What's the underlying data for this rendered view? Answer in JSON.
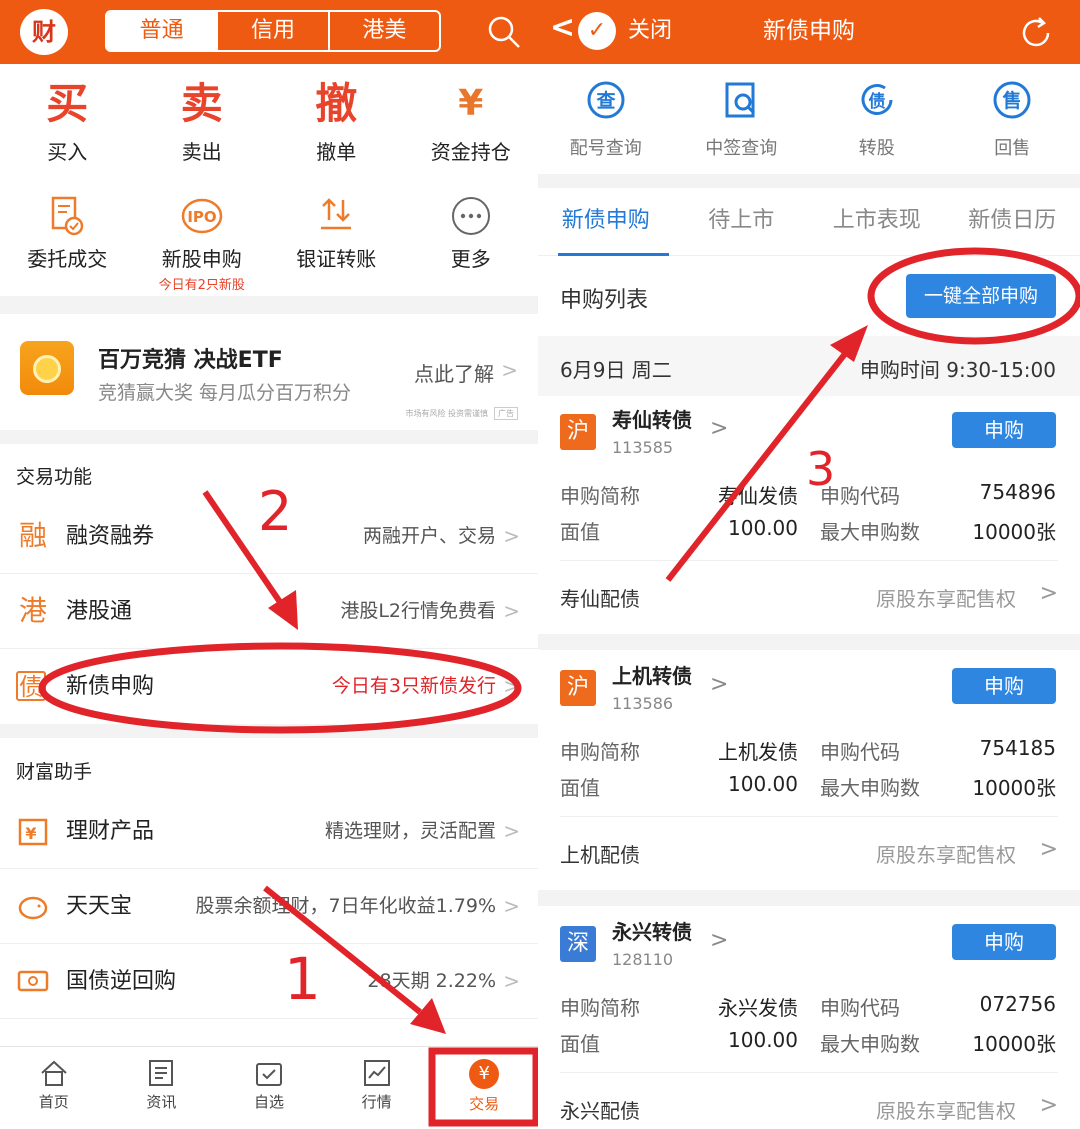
{
  "left": {
    "header": {
      "avatar_glyph": "财",
      "segments": [
        "普通",
        "信用",
        "港美"
      ]
    },
    "main_actions": [
      {
        "glyph": "买",
        "label": "买入"
      },
      {
        "glyph": "卖",
        "label": "卖出"
      },
      {
        "glyph": "撤",
        "label": "撤单"
      },
      {
        "glyph": "¥",
        "label": "资金持仓"
      }
    ],
    "sub_actions": [
      {
        "label": "委托成交",
        "sub": ""
      },
      {
        "label": "新股申购",
        "sub": "今日有2只新股"
      },
      {
        "label": "银证转账",
        "sub": ""
      },
      {
        "label": "更多",
        "sub": ""
      }
    ],
    "promo": {
      "title": "百万竞猜 决战ETF",
      "subtitle": "竞猜赢大奖 每月瓜分百万积分",
      "cta": "点此了解",
      "disclaimer": "市场有风险 投资需谨慎",
      "ad_tag": "广告"
    },
    "trade_section": {
      "title": "交易功能",
      "rows": [
        {
          "icon_glyph": "融",
          "label": "融资融券",
          "right": "两融开户、交易"
        },
        {
          "icon_glyph": "港",
          "label": "港股通",
          "right": "港股L2行情免费看"
        },
        {
          "icon_glyph": "债",
          "label": "新债申购",
          "right": "今日有3只新债发行"
        }
      ]
    },
    "wealth_section": {
      "title": "财富助手",
      "rows": [
        {
          "label": "理财产品",
          "right": "精选理财，灵活配置"
        },
        {
          "label": "天天宝",
          "right": "股票余额理财，7日年化收益1.79%"
        },
        {
          "label": "国债逆回购",
          "right": "28天期 2.22%"
        }
      ]
    },
    "bottom_nav": [
      {
        "label": "首页",
        "icon": "home-icon"
      },
      {
        "label": "资讯",
        "icon": "news-icon"
      },
      {
        "label": "自选",
        "icon": "watchlist-icon"
      },
      {
        "label": "行情",
        "icon": "market-icon"
      },
      {
        "label": "交易",
        "icon": "trade-icon"
      }
    ],
    "annotations": [
      "2",
      "1"
    ]
  },
  "right": {
    "header": {
      "back": "<",
      "close": "关闭",
      "title": "新债申购"
    },
    "quick_icons": [
      {
        "glyph": "查",
        "label": "配号查询"
      },
      {
        "glyph": "",
        "label": "中签查询"
      },
      {
        "glyph": "债",
        "label": "转股"
      },
      {
        "glyph": "售",
        "label": "回售"
      }
    ],
    "tabs": [
      "新债申购",
      "待上市",
      "上市表现",
      "新债日历"
    ],
    "list_title": "申购列表",
    "subscribe_all": "一键全部申购",
    "date": "6月9日 周二",
    "time": "申购时间 9:30-15:00",
    "annotation": "3",
    "field_labels": {
      "short_name": "申购简称",
      "code": "申购代码",
      "face": "面值",
      "max": "最大申购数"
    },
    "bonds": [
      {
        "market": "沪",
        "market_color": "#ee6a1c",
        "name": "寿仙转债",
        "code": "113585",
        "btn": "申购",
        "short_name": "寿仙发债",
        "sub_code": "754896",
        "face": "100.00",
        "max": "10000张",
        "alloc_name": "寿仙配债",
        "alloc_right": "原股东享配售权"
      },
      {
        "market": "沪",
        "market_color": "#ee6a1c",
        "name": "上机转债",
        "code": "113586",
        "btn": "申购",
        "short_name": "上机发债",
        "sub_code": "754185",
        "face": "100.00",
        "max": "10000张",
        "alloc_name": "上机配债",
        "alloc_right": "原股东享配售权"
      },
      {
        "market": "深",
        "market_color": "#3a7bd5",
        "name": "永兴转债",
        "code": "128110",
        "btn": "申购",
        "short_name": "永兴发债",
        "sub_code": "072756",
        "face": "100.00",
        "max": "10000张",
        "alloc_name": "永兴配债",
        "alloc_right": "原股东享配售权"
      }
    ]
  },
  "colors": {
    "brand_orange": "#ee5a12",
    "accent_blue": "#2e86e0",
    "annotation_red": "#e0242a"
  }
}
